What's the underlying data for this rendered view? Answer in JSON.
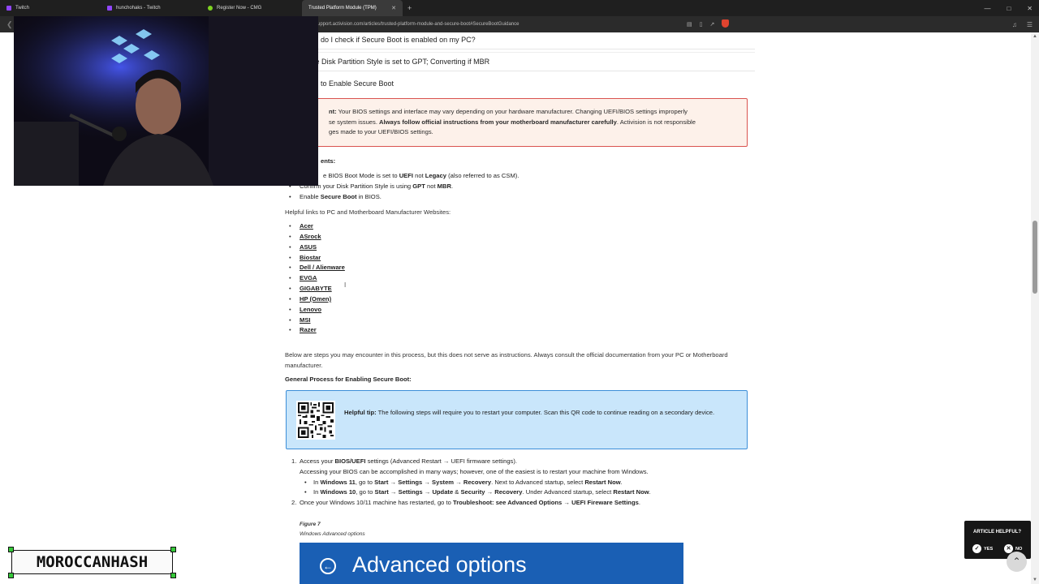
{
  "browser": {
    "tabs": [
      {
        "title": "Twitch",
        "favicon_color": "#9146ff",
        "active": false
      },
      {
        "title": "hunchohaks - Twitch",
        "favicon_color": "#9146ff",
        "active": false
      },
      {
        "title": "Register Now - CMG",
        "favicon_color": "#7ed321",
        "active": false
      },
      {
        "title": "Trusted Platform Module (TPM)",
        "favicon_color": "#3a3a3a",
        "active": true
      }
    ],
    "new_tab_label": "+",
    "url": "support.activision.com/articles/trusted-platform-module-and-secure-boot#SecureBootGuidance"
  },
  "accordion": {
    "item1": "do I check if Secure Boot is enabled on my PC?",
    "item2": "irm the Disk Partition Style is set to GPT; Converting if MBR",
    "item3": "to Enable Secure Boot"
  },
  "warning": {
    "label": "nt:",
    "text1": " Your BIOS settings and interface may vary depending on your hardware manufacturer. Changing UEFI/BIOS settings improperly",
    "text2a": "se system issues. ",
    "bold": "Always follow official instructions from your motherboard manufacturer carefully",
    "text2b": ". Activision is not responsible",
    "text3": "ges made to your UEFI/BIOS settings."
  },
  "requirements": {
    "title": "ents:",
    "items": [
      {
        "pre": "e BIOS Boot Mode is set to ",
        "b1": "UEFI",
        "mid": " not ",
        "b2": "Legacy",
        "post": " (also referred to as CSM)."
      },
      {
        "pre": "Confirm your Disk Partition Style is using ",
        "b1": "GPT",
        "mid": " not ",
        "b2": "MBR",
        "post": "."
      },
      {
        "pre": "Enable ",
        "b1": "Secure Boot",
        "mid": " in BIOS.",
        "b2": "",
        "post": ""
      }
    ]
  },
  "helpful_links_label": "Helpful links to PC and Motherboard Manufacturer Websites:",
  "manufacturers": [
    "Acer",
    "ASrock",
    "ASUS",
    "Biostar",
    "Dell / Alienware",
    "EVGA",
    "GIGABYTE",
    "HP (Omen)",
    "Lenovo",
    "MSI",
    "Razer"
  ],
  "below_text": "Below are steps you may encounter in this process, but this does not serve as instructions. Always consult the official documentation from your PC or Motherboard manufacturer.",
  "general_process_title": "General Process for Enabling Secure Boot:",
  "tip": {
    "label": "Helpful tip:",
    "text": " The following steps will require you to restart your computer. Scan this QR code to continue reading on a secondary device."
  },
  "steps": {
    "s1_num": "1.",
    "s1_pre": "Access your ",
    "s1_bold": "BIOS/UEFI",
    "s1_post": " settings (Advanced Restart → UEFI firmware settings).",
    "s1_line2": "Accessing your BIOS can be accomplished in many ways; however, one of the easiest is to restart your machine from Windows.",
    "w11": {
      "in": "In ",
      "os": "Windows 11",
      "go": ", go to ",
      "a": "Start",
      "arr1": " → ",
      "b": "Settings",
      "arr2": " → ",
      "c": "System",
      "arr3": " → ",
      "d": "Recovery",
      "next": ". Next to Advanced startup, select ",
      "e": "Restart Now",
      "end": "."
    },
    "w10": {
      "in": "In ",
      "os": "Windows 10",
      "go": ", go to ",
      "a": "Start",
      "arr1": " → ",
      "b": "Settings",
      "arr2": " → ",
      "c": "Update",
      "amp": " & ",
      "c2": "Security",
      "arr3": " → ",
      "d": "Recovery",
      "next": ". Under Advanced startup, select ",
      "e": "Restart Now",
      "end": "."
    },
    "s2_num": "2.",
    "s2_pre": "Once your Windows 10/11 machine has restarted, go to ",
    "s2_bold": "Troubleshoot: see Advanced Options → UEFI Fireware Settings",
    "s2_post": "."
  },
  "figure": {
    "label": "Figure 7",
    "caption": "Windows Advanced options",
    "screen_title": "Advanced options",
    "back_glyph": "←"
  },
  "article_helpful": {
    "question": "ARTICLE HELPFUL?",
    "yes": "YES",
    "no": "NO"
  },
  "watermark": "MOROCCANHASH",
  "colors": {
    "warning_border": "#d9534f",
    "warning_bg": "#fdf1ea",
    "tip_bg": "#c9e6fb",
    "tip_border": "#3c8ed8",
    "advanced_options_bg": "#1a5fb4",
    "watermark_corner": "#36c83a"
  }
}
